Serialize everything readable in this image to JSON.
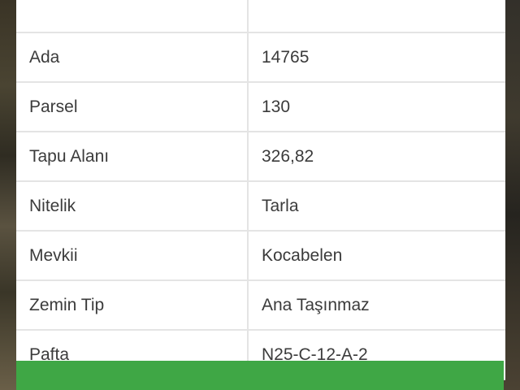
{
  "parcel_table": {
    "rows": [
      {
        "label": "",
        "value": ""
      },
      {
        "label": "Ada",
        "value": "14765"
      },
      {
        "label": "Parsel",
        "value": "130"
      },
      {
        "label": "Tapu Alanı",
        "value": "326,82"
      },
      {
        "label": "Nitelik",
        "value": "Tarla"
      },
      {
        "label": "Mevkii",
        "value": "Kocabelen"
      },
      {
        "label": "Zemin Tip",
        "value": "Ana Taşınmaz"
      },
      {
        "label": "Pafta",
        "value": "N25-C-12-A-2"
      }
    ]
  },
  "action_button": {
    "label": ""
  },
  "colors": {
    "button_green": "#3fa745",
    "row_background": "#ffffff",
    "border": "#e4e4e4",
    "text": "#3b3b3b"
  }
}
